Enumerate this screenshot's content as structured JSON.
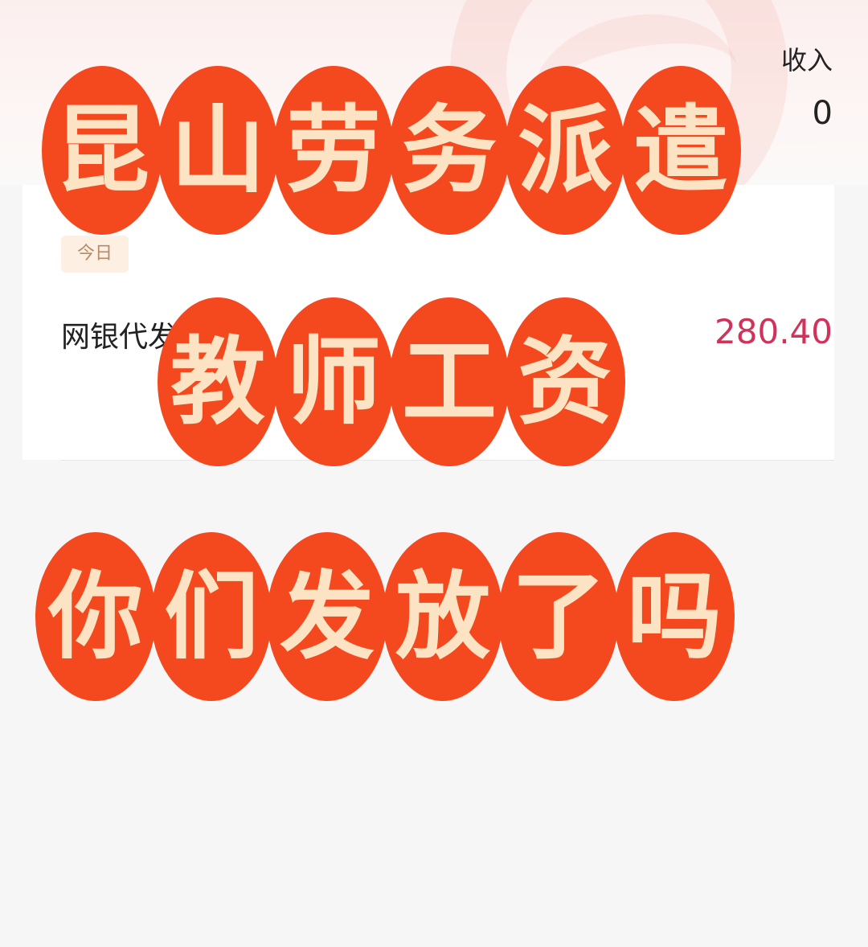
{
  "header": {
    "income_label": "收入",
    "income_value_partial": "0"
  },
  "transactions": {
    "date_badge": "今日",
    "items": [
      {
        "title_partial": "网银代发",
        "amount_partial": "280.40",
        "amount_color": "#d0325a"
      }
    ]
  },
  "overlay": {
    "bubble_color": "#f4481e",
    "text_color": "#fbe3c4",
    "line1": [
      "昆",
      "山",
      "劳",
      "务",
      "派",
      "遣"
    ],
    "line2": [
      "教",
      "师",
      "工",
      "资"
    ],
    "line3": [
      "你",
      "们",
      "发",
      "放",
      "了",
      "吗"
    ]
  }
}
